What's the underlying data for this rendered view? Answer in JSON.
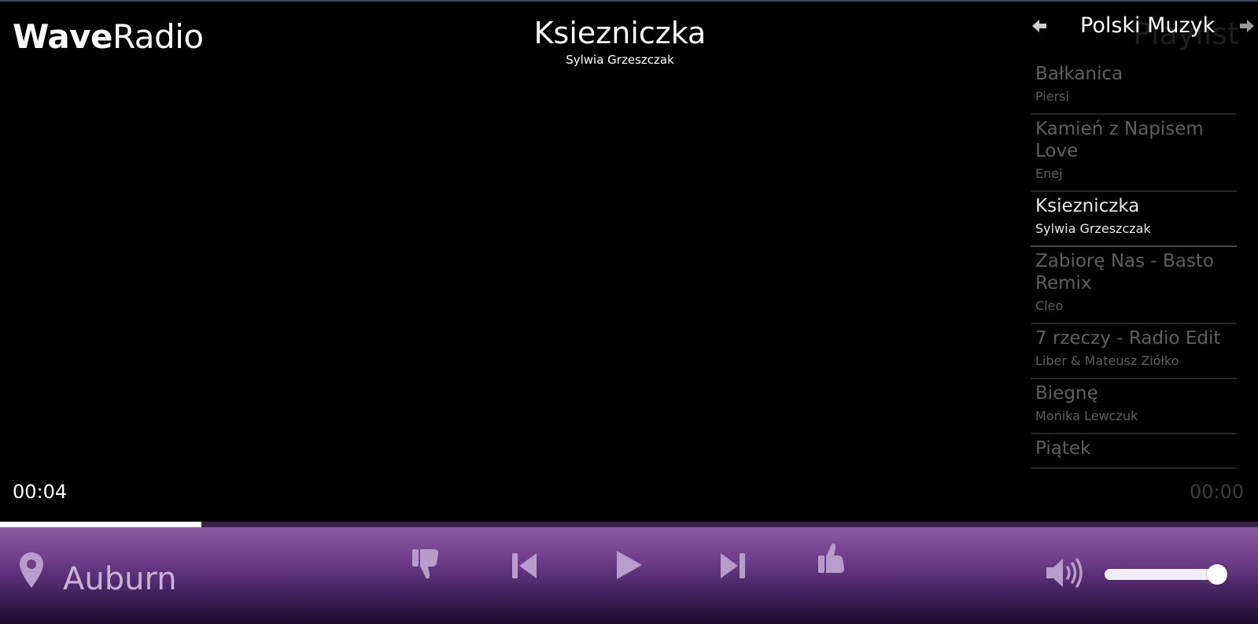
{
  "app": {
    "logo_bold": "Wave",
    "logo_regular": "Radio"
  },
  "now_playing": {
    "title": "Ksiezniczka",
    "artist": "Sylwia Grzeszczak",
    "elapsed": "00:04",
    "duration": "00:00",
    "progress_fraction": 0.16
  },
  "playlist": {
    "heading": "Playlist",
    "name": "Polski Muzyk",
    "prev_icon": "arrow-left-icon",
    "next_icon": "arrow-right-icon",
    "active_index": 2,
    "items": [
      {
        "title": "Bałkanica",
        "artist": "Piersi"
      },
      {
        "title": "Kamień z Napisem Love",
        "artist": "Enej"
      },
      {
        "title": "Ksiezniczka",
        "artist": "Sylwia Grzeszczak"
      },
      {
        "title": "Zabiorę Nas - Basto Remix",
        "artist": "Cleo"
      },
      {
        "title": "7 rzeczy - Radio Edit",
        "artist": "Liber & Mateusz Ziółko"
      },
      {
        "title": "Biegnę",
        "artist": "Monika Lewczuk"
      },
      {
        "title": "Piątek",
        "artist": ""
      }
    ]
  },
  "location": {
    "icon": "map-pin-icon",
    "city": "Auburn"
  },
  "controls": {
    "dislike_icon": "thumbs-down-icon",
    "previous_icon": "skip-previous-icon",
    "play_icon": "play-icon",
    "next_icon": "skip-next-icon",
    "like_icon": "thumbs-up-icon"
  },
  "volume": {
    "icon": "volume-icon",
    "level_fraction": 0.95
  },
  "colors": {
    "background": "#000000",
    "accent_purple": "#6d3d8a",
    "icon_color": "#b99ccb",
    "playlist_inactive": "#5f5f5f",
    "playlist_active": "#e8e8e8"
  }
}
